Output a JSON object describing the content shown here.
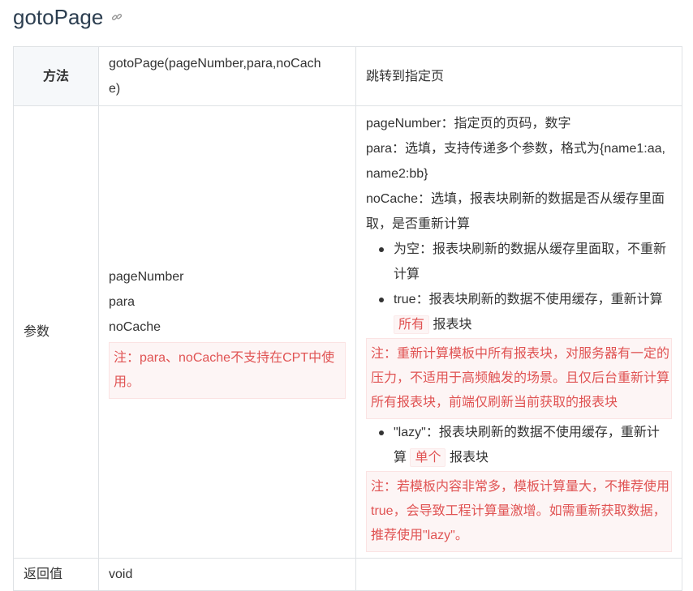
{
  "page": {
    "title": "gotoPage",
    "anchor_icon": "link-icon"
  },
  "table": {
    "method_row": {
      "label": "方法",
      "signature_lines": [
        "gotoPage(pageNumber,para,noCach",
        "e)"
      ],
      "description": "跳转到指定页"
    },
    "params_row": {
      "label": "参数",
      "names": [
        "pageNumber",
        "para",
        "noCache"
      ],
      "names_note_lines": [
        "注：para、noCache不支持在CPT中使",
        "用。"
      ],
      "detail_lines": [
        "pageNumber：指定页的页码，数字",
        "para：选填，支持传递多个参数，格式为{name1:aa,",
        "name2:bb}",
        "noCache：选填，报表块刷新的数据是否从缓存里面",
        "取，是否重新计算"
      ],
      "bullet1_lines": [
        "为空：报表块刷新的数据从缓存里面取，不重新",
        "计算"
      ],
      "bullet2_line1": "true：报表块刷新的数据不使用缓存，重新计算",
      "bullet2_code": "所有",
      "bullet2_tail": "报表块",
      "note1_lines": [
        "注：重新计算模板中所有报表块，对服务器有一定的",
        "压力，不适用于高频触发的场景。且仅后台重新计算",
        "所有报表块，前端仅刷新当前获取的报表块"
      ],
      "bullet3_line1": "\"lazy\"：报表块刷新的数据不使用缓存，重新计",
      "bullet3_pre": "算",
      "bullet3_code": "单个",
      "bullet3_tail": "报表块",
      "note2_lines": [
        "注：若模板内容非常多，模板计算量大，不推荐使用",
        "true，会导致工程计算量激增。如需重新获取数据，",
        "推荐使用\"lazy\"。"
      ]
    },
    "return_row": {
      "label": "返回值",
      "value": "void"
    }
  },
  "colors": {
    "note_text": "#e05353",
    "note_bg": "#fdf5f5",
    "border": "#dfe2e5",
    "header_bg": "#f6f8fa"
  }
}
